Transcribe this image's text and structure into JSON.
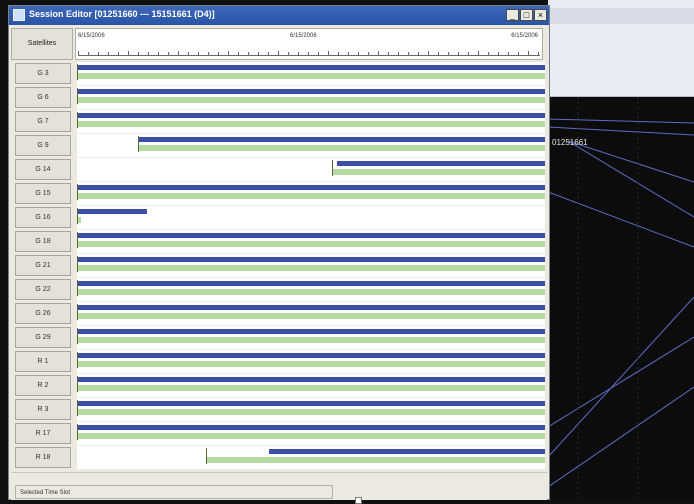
{
  "window": {
    "title": "Session Editor [01251660 --- 15151661 (D4)]",
    "min_glyph": "_",
    "max_glyph": "□",
    "close_glyph": "×"
  },
  "header": {
    "satellites_label": "Satellites",
    "time_labels": [
      "6/15/2006",
      "6/15/2006",
      "6/15/2006"
    ]
  },
  "rows": [
    {
      "sat": "G 3",
      "blue": [
        0.0,
        1.0
      ],
      "green": [
        0.0,
        1.0
      ]
    },
    {
      "sat": "G 6",
      "blue": [
        0.0,
        1.0
      ],
      "green": [
        0.0,
        1.0
      ]
    },
    {
      "sat": "G 7",
      "blue": [
        0.0,
        1.0
      ],
      "green": [
        0.0,
        1.0
      ]
    },
    {
      "sat": "G 9",
      "blue": [
        0.13,
        1.0
      ],
      "green": [
        0.13,
        1.0
      ]
    },
    {
      "sat": "G 14",
      "blue": [
        0.555,
        1.0
      ],
      "green": [
        0.545,
        1.0
      ]
    },
    {
      "sat": "G 15",
      "blue": [
        0.0,
        1.0
      ],
      "green": [
        0.0,
        1.0
      ]
    },
    {
      "sat": "G 16",
      "blue": [
        0.0,
        0.15
      ],
      "green": [
        0.0,
        0.008
      ]
    },
    {
      "sat": "G 18",
      "blue": [
        0.0,
        1.0
      ],
      "green": [
        0.0,
        1.0
      ]
    },
    {
      "sat": "G 21",
      "blue": [
        0.0,
        1.0
      ],
      "green": [
        0.0,
        1.0
      ]
    },
    {
      "sat": "G 22",
      "blue": [
        0.0,
        1.0
      ],
      "green": [
        0.0,
        1.0
      ]
    },
    {
      "sat": "G 26",
      "blue": [
        0.0,
        1.0
      ],
      "green": [
        0.0,
        1.0
      ]
    },
    {
      "sat": "G 29",
      "blue": [
        0.0,
        1.0
      ],
      "green": [
        0.0,
        1.0
      ]
    },
    {
      "sat": "R 1",
      "blue": [
        0.0,
        1.0
      ],
      "green": [
        0.0,
        1.0
      ]
    },
    {
      "sat": "R 2",
      "blue": [
        0.0,
        1.0
      ],
      "green": [
        0.0,
        1.0
      ]
    },
    {
      "sat": "R 3",
      "blue": [
        0.0,
        1.0
      ],
      "green": [
        0.0,
        1.0
      ]
    },
    {
      "sat": "R 17",
      "blue": [
        0.0,
        1.0
      ],
      "green": [
        0.0,
        1.0
      ]
    },
    {
      "sat": "R 18",
      "blue": [
        0.41,
        1.0
      ],
      "green": [
        0.275,
        1.0
      ]
    }
  ],
  "bottom": {
    "selected_time_slot_label": "Selected Time Slot"
  },
  "background_app": {
    "session_label": "01251661"
  },
  "colors": {
    "blue_bar": "#3b4fa6",
    "green_bar": "#b5dca0",
    "titlebar": "#2a55a8"
  }
}
